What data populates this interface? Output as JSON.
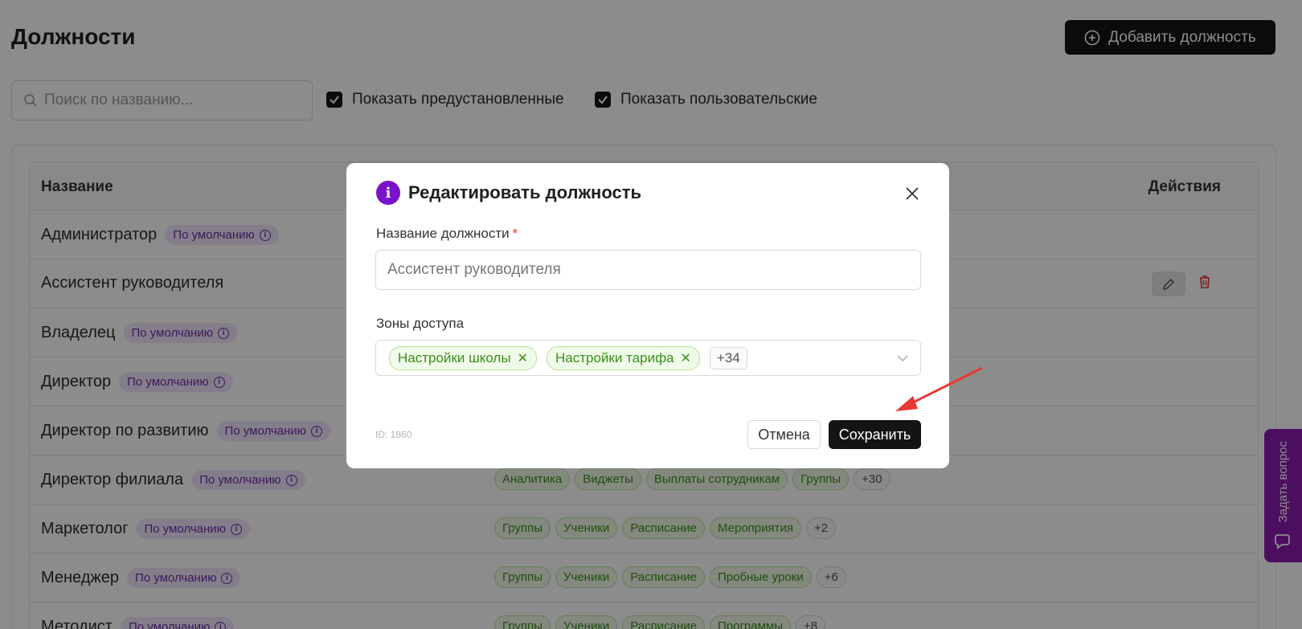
{
  "page": {
    "title": "Должности",
    "add_button": "Добавить должность",
    "search_placeholder": "Поиск по названию...",
    "filters": [
      "Показать предустановленные",
      "Показать пользовательские"
    ]
  },
  "table": {
    "headers": {
      "name": "Название",
      "actions": "Действия"
    },
    "badge_label": "По умолчанию",
    "rows": [
      {
        "name": "Администратор",
        "badge": true,
        "zones": [],
        "more": ""
      },
      {
        "name": "Ассистент руководителя",
        "badge": false,
        "zones": [],
        "more": ""
      },
      {
        "name": "Владелец",
        "badge": true,
        "zones": [],
        "more": ""
      },
      {
        "name": "Директор",
        "badge": true,
        "zones": [],
        "more": ""
      },
      {
        "name": "Директор по развитию",
        "badge": true,
        "zones": [],
        "more": ""
      },
      {
        "name": "Директор филиала",
        "badge": true,
        "zones": [
          "Аналитика",
          "Виджеты",
          "Выплаты сотрудникам",
          "Группы"
        ],
        "more": "+30"
      },
      {
        "name": "Маркетолог",
        "badge": true,
        "zones": [
          "Группы",
          "Ученики",
          "Расписание",
          "Мероприятия"
        ],
        "more": "+2"
      },
      {
        "name": "Менеджер",
        "badge": true,
        "zones": [
          "Группы",
          "Ученики",
          "Расписание",
          "Пробные уроки"
        ],
        "more": "+6"
      },
      {
        "name": "Методист",
        "badge": true,
        "zones": [
          "Группы",
          "Ученики",
          "Расписание",
          "Программы"
        ],
        "more": "+8"
      }
    ]
  },
  "side_tab": {
    "label": "Задать вопрос"
  },
  "modal": {
    "title": "Редактировать должность",
    "name_label": "Название должности",
    "required_mark": "*",
    "name_value": "Ассистент руководителя",
    "zones_label": "Зоны доступа",
    "zone_tags": [
      "Настройки школы",
      "Настройки тарифа"
    ],
    "zone_more": "+34",
    "id_text": "ID: 1860",
    "cancel_label": "Отмена",
    "save_label": "Сохранить"
  },
  "colors": {
    "accent_purple": "#7a12c9",
    "arrow_red": "#e53935",
    "tag_green": "#3a8f1c"
  }
}
